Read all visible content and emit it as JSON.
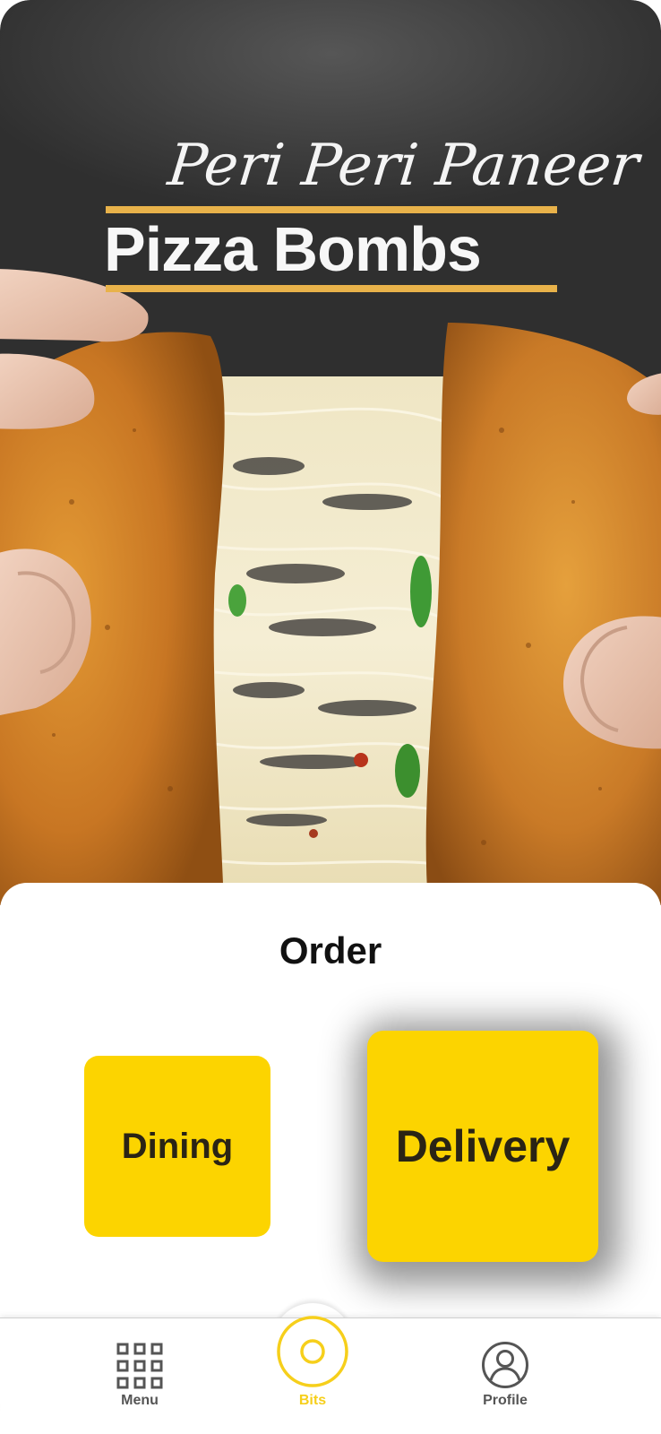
{
  "hero": {
    "script_title": "Peri Peri Paneer",
    "main_title": "Pizza Bombs"
  },
  "order": {
    "title": "Order",
    "options": {
      "dining": "Dining",
      "delivery": "Delivery"
    }
  },
  "nav": {
    "items": [
      {
        "label": "Menu",
        "icon": "grid-icon",
        "active": false
      },
      {
        "label": "Bits",
        "icon": "ring-icon",
        "active": true
      },
      {
        "label": "Profile",
        "icon": "user-icon",
        "active": false
      }
    ]
  },
  "colors": {
    "accent": "#FCD400",
    "title_bar": "#E8B24A",
    "nav_active": "#F6CF1B",
    "nav_inactive": "#555555"
  }
}
